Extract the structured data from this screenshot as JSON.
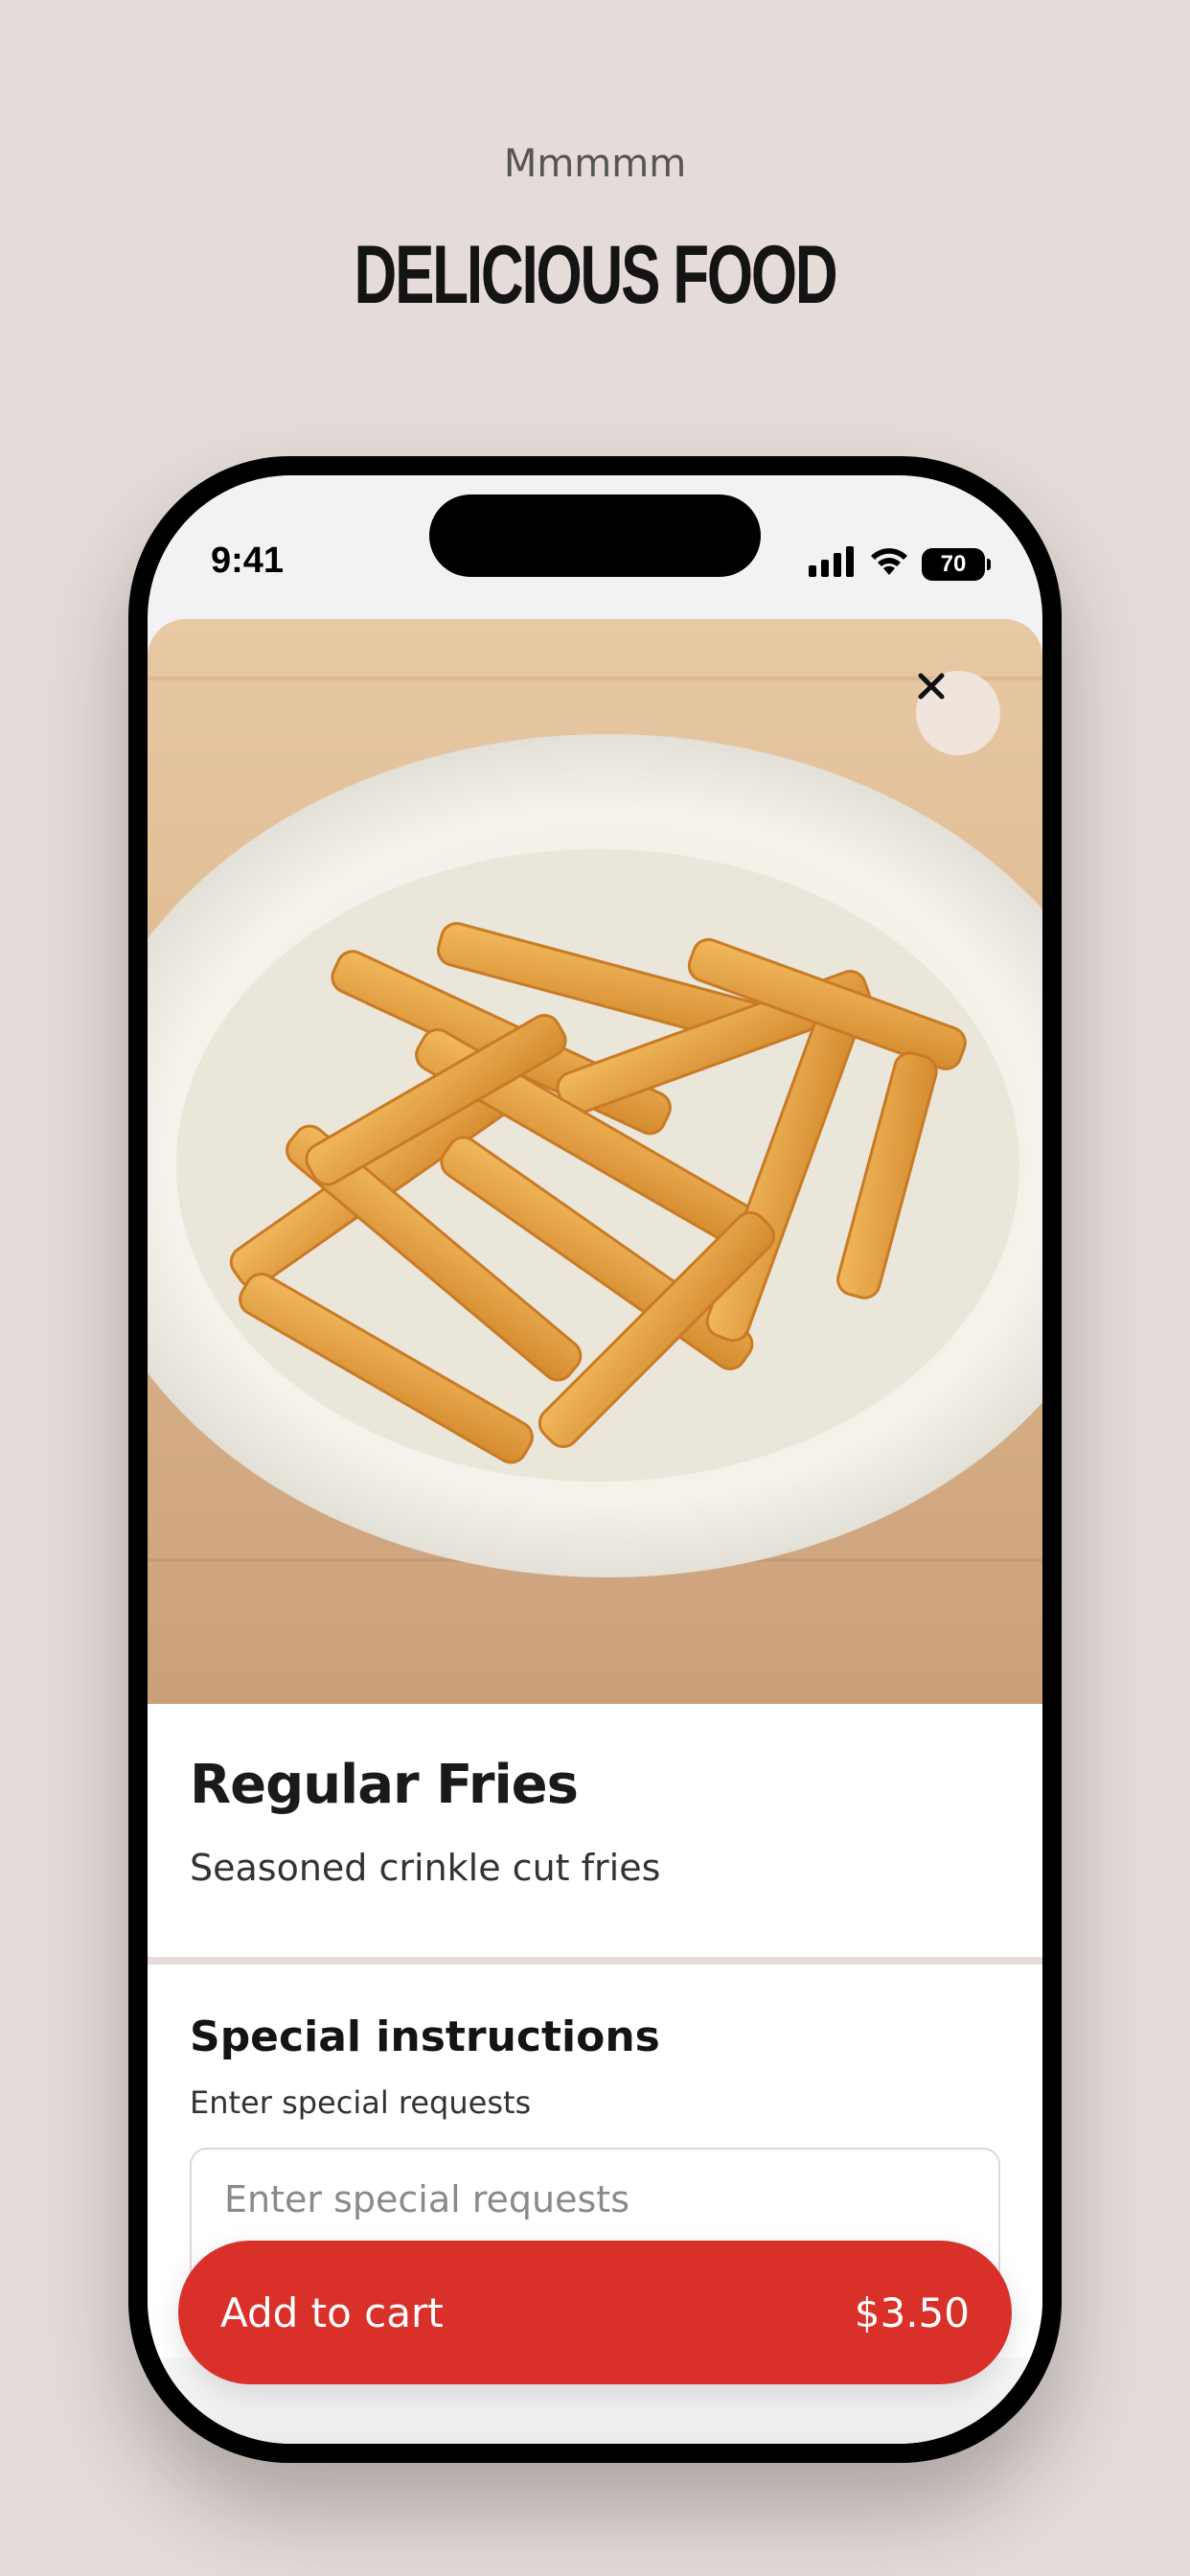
{
  "header": {
    "kicker": "Mmmmm",
    "headline": "DELICIOUS FOOD"
  },
  "status_bar": {
    "time": "9:41",
    "battery": "70",
    "icons": [
      "signal-icon",
      "wifi-icon",
      "battery-icon"
    ]
  },
  "product": {
    "name": "Regular Fries",
    "description": "Seasoned crinkle cut fries",
    "image_alt_icon": "fries-plate-image"
  },
  "instructions": {
    "title": "Special instructions",
    "subtitle": "Enter special requests",
    "placeholder": "Enter special requests"
  },
  "cart": {
    "label": "Add to cart",
    "price": "$3.50"
  },
  "colors": {
    "background": "#e5dcd9",
    "accent": "#d9302a",
    "close_button_bg": "#f1e4dc"
  }
}
